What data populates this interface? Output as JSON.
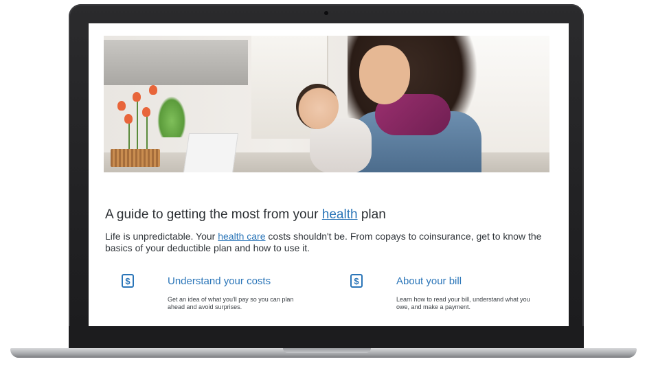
{
  "page": {
    "headline_prefix": "A guide to getting the most from your ",
    "headline_link": "health",
    "headline_suffix": " plan",
    "intro_prefix": "Life is unpredictable. Your ",
    "intro_link": "health care",
    "intro_suffix": " costs shouldn't be. From copays to coinsurance, get to know the basics of your deductible plan and how to use it."
  },
  "cards": [
    {
      "icon": "document-dollar-icon",
      "icon_glyph": "$",
      "title": "Understand your costs",
      "description": "Get an idea of what you'll pay so you can plan ahead and avoid surprises."
    },
    {
      "icon": "bill-dollar-icon",
      "icon_glyph": "$",
      "title": "About your bill",
      "description": "Learn how to read your bill, understand what you owe, and make a payment."
    }
  ],
  "colors": {
    "link": "#2a75b8",
    "text": "#2b2f33",
    "laptop_bezel": "#1b1b1d"
  }
}
